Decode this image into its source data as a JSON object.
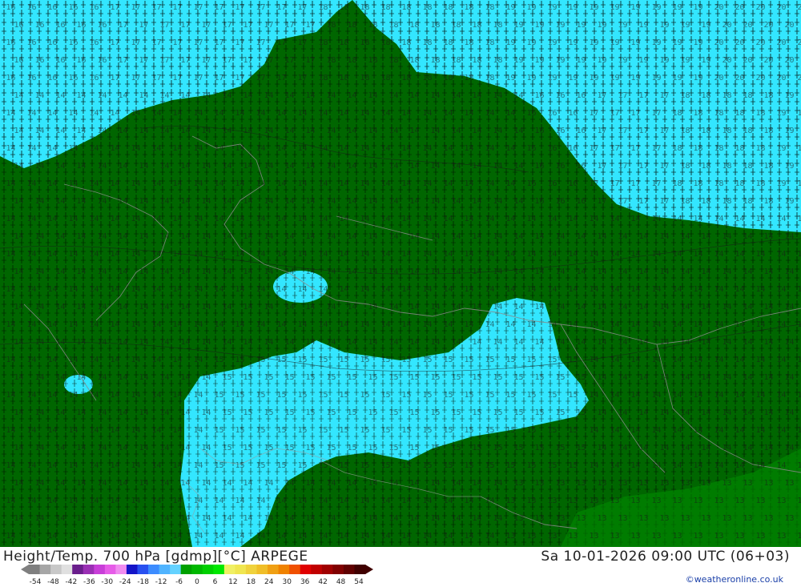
{
  "header": {
    "title_left": "Height/Temp. 700 hPa [gdmp][°C] ARPEGE",
    "title_right": "Sa 10-01-2026 09:00 UTC (06+03)",
    "credit": "©weatheronline.co.uk"
  },
  "legend": {
    "ticks": [
      "-54",
      "-48",
      "-42",
      "-36",
      "-30",
      "-24",
      "-18",
      "-12",
      "-6",
      "0",
      "6",
      "12",
      "18",
      "24",
      "30",
      "36",
      "42",
      "48",
      "54"
    ],
    "colors": [
      "#7f7f7f",
      "#a6a6a6",
      "#c8c8c8",
      "#e0e0e0",
      "#6a1e8c",
      "#9a2fb4",
      "#c83ed8",
      "#e65ce8",
      "#f08cf0",
      "#1414c8",
      "#2850f0",
      "#3c8cff",
      "#50b4ff",
      "#64d2ff",
      "#00a000",
      "#00b800",
      "#00d000",
      "#00e800",
      "#f0f064",
      "#f0e650",
      "#f0d23c",
      "#f0be28",
      "#f0a014",
      "#f08200",
      "#f05000",
      "#e00000",
      "#c00000",
      "#a00000",
      "#800000",
      "#600000",
      "#400000"
    ]
  },
  "map": {
    "colors": {
      "cold_cyan": "#33e6ff",
      "dark_green": "#006600",
      "lime_band": "#008a00",
      "border": "#8a8a8a",
      "contour_text": "#1a1a1a"
    },
    "contour_labels": [
      "13",
      "14",
      "15",
      "16",
      "17",
      "18",
      "19",
      "20",
      "21"
    ]
  }
}
